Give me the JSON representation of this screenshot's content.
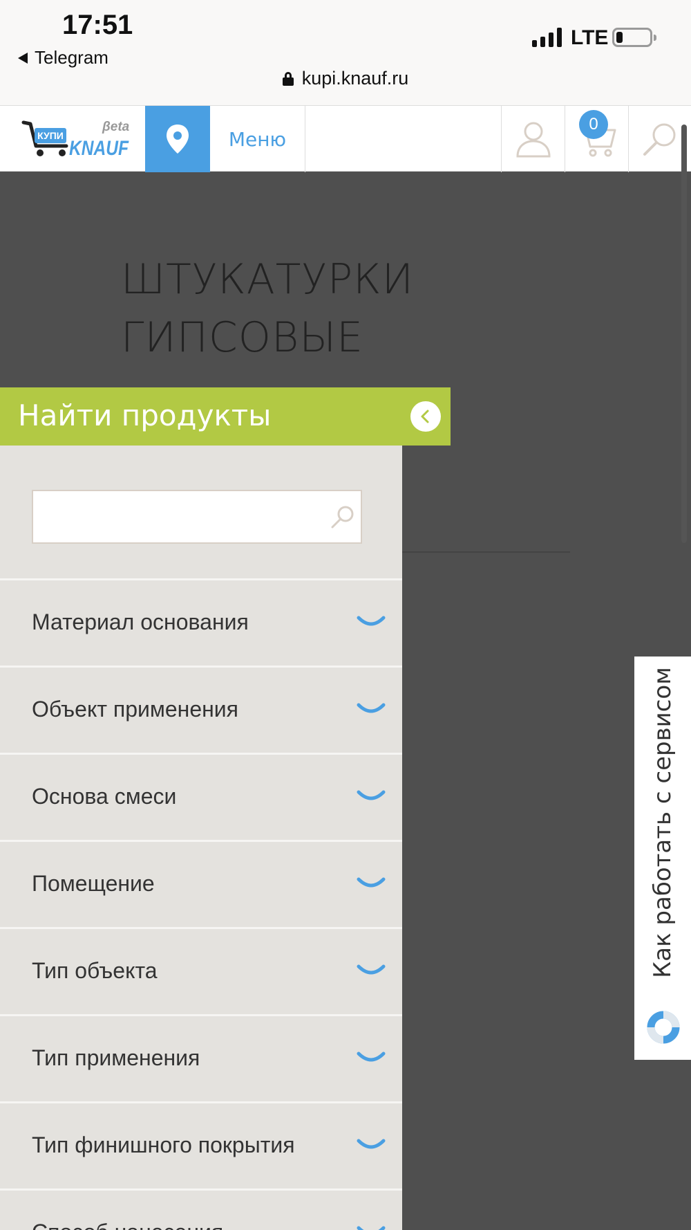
{
  "status_bar": {
    "time": "17:51",
    "back_app": "Telegram",
    "network": "LTE",
    "battery_level": 0.2,
    "url": "kupi.knauf.ru"
  },
  "header": {
    "logo": {
      "brand": "KNAUF",
      "prefix": "КУПИ",
      "badge": "βeta"
    },
    "menu_label": "Меню",
    "cart_count": "0",
    "colors": {
      "accent": "#4a9fe2",
      "icon": "#d8cfc6"
    }
  },
  "page": {
    "title_line1": "ШТУКАТУРКИ",
    "title_line2": "ГИПСОВЫЕ"
  },
  "filter": {
    "title": "Найти продукты",
    "search_placeholder": "",
    "colors": {
      "bar": "#b2c944",
      "panel": "#e4e2de"
    },
    "items": [
      {
        "label": "Материал основания"
      },
      {
        "label": "Объект применения"
      },
      {
        "label": "Основа смеси"
      },
      {
        "label": "Помещение"
      },
      {
        "label": "Тип объекта"
      },
      {
        "label": "Тип применения"
      },
      {
        "label": "Тип финишного покрытия"
      },
      {
        "label": "Способ нанесения"
      }
    ]
  },
  "service_tab": {
    "label": "Как работать с сервисом"
  }
}
